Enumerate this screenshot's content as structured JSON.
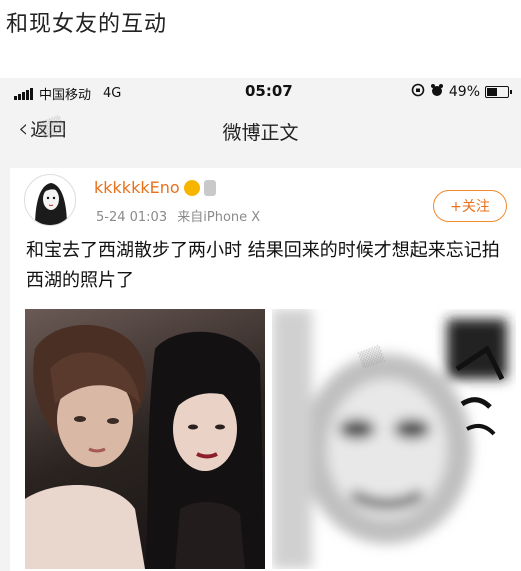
{
  "caption": "和现女友的互动",
  "statusbar": {
    "carrier": "中国移动",
    "network": "4G",
    "time": "05:07",
    "battery": "49%",
    "battery_level": 0.49
  },
  "navbar": {
    "back_label": "返回",
    "title": "微博正文"
  },
  "post": {
    "username": "kkkkkkEno",
    "timestamp": "5-24 01:03",
    "source": "来自iPhone X",
    "follow_label": "+关注",
    "text": "和宝去了西湖散步了两小时 结果回来的时候才想起来忘记拍西湖的照片了"
  },
  "colors": {
    "accent": "#e8711c",
    "follow_border": "#f08a2c",
    "meta_text": "#8a8a8a"
  },
  "icons": {
    "back": "chevron-left-icon",
    "alarm": "alarm-icon",
    "rotation_lock": "rotation-lock-icon",
    "battery": "battery-icon",
    "signal": "signal-icon"
  }
}
